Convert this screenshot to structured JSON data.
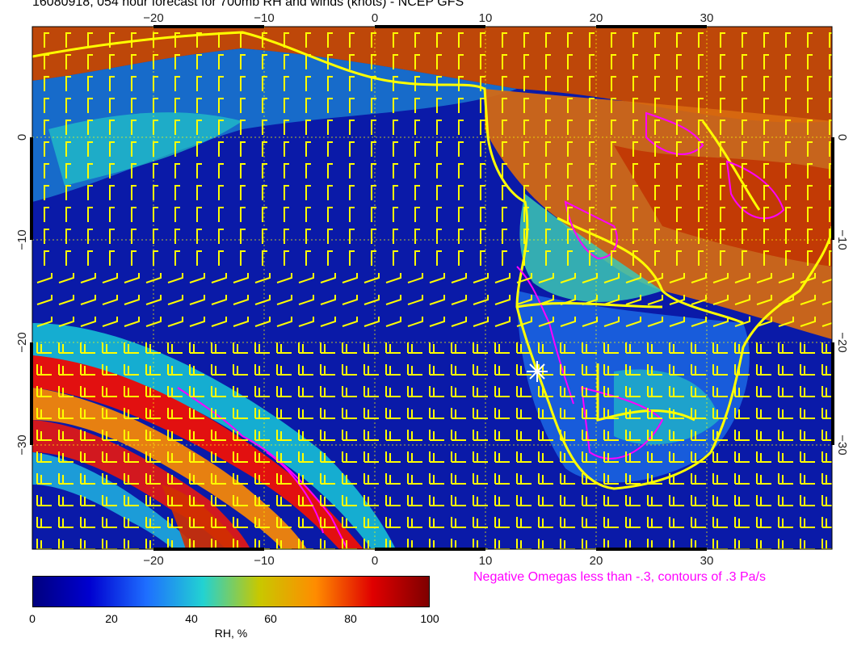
{
  "title": "16080918, 054 hour forecast for 700mb RH and winds (knots) - NCEP GFS",
  "map": {
    "lon_range": [
      -30,
      42
    ],
    "lat_range": [
      -40,
      10
    ],
    "lon_ticks": [
      -20,
      -10,
      0,
      10,
      20,
      30
    ],
    "lat_ticks": [
      0,
      -10,
      -20,
      -30
    ],
    "lon_tick_labels": [
      "−20",
      "−10",
      "0",
      "10",
      "20",
      "30"
    ],
    "lat_tick_labels": [
      "0",
      "−10",
      "−20",
      "−30"
    ],
    "marker": {
      "symbol": "white-star",
      "lon": 14.5,
      "lat": -23
    }
  },
  "legend": {
    "omega_note": "Negative Omegas less than -.3, contours of .3 Pa/s",
    "colorbar_label": "RH, %",
    "colorbar_ticks": [
      "0",
      "20",
      "40",
      "60",
      "80",
      "100"
    ],
    "colorbar_colors": [
      "#00007f",
      "#0000d0",
      "#1e6eff",
      "#22d2d2",
      "#c8c800",
      "#ff8c00",
      "#e00000",
      "#7f0000"
    ]
  },
  "colors": {
    "wind_barbs": "#ffff00",
    "coastline": "#ffff00",
    "omega_contours": "#ff00ff",
    "grid": "#ffff00"
  }
}
